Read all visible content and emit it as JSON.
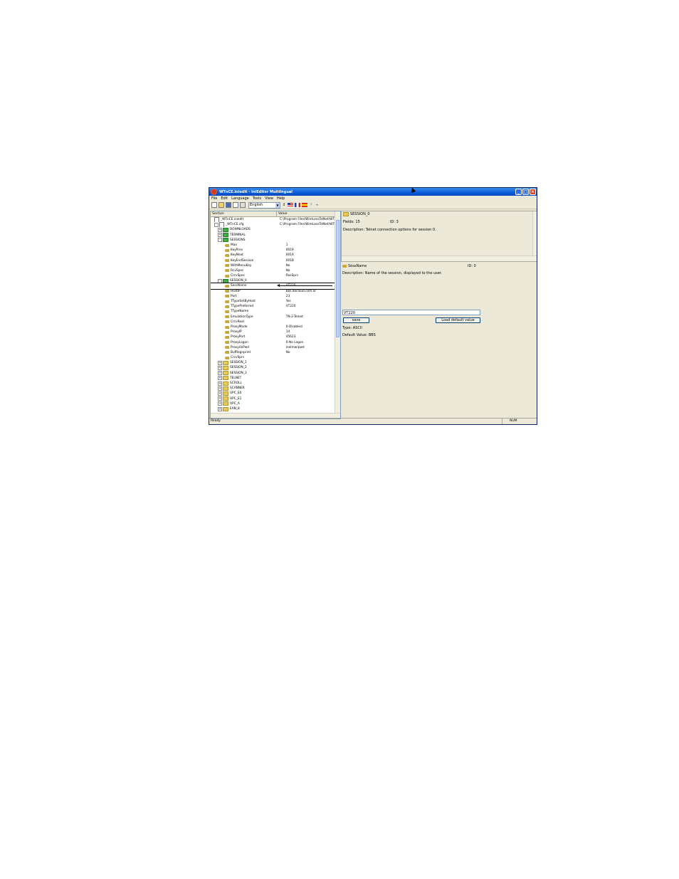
{
  "window": {
    "title": "WTnCE.inledit - IniEditor MultiIngual"
  },
  "menu": [
    "File",
    "Edit",
    "Language",
    "Tools",
    "View",
    "Help"
  ],
  "toolbar": {
    "language": "English"
  },
  "tree": {
    "headers": {
      "section": "Section",
      "value": "Value"
    },
    "rows": [
      {
        "label": "_WTnCE.iniedit",
        "value": "C:\\Program Files\\WireLessTelNet\\WTn",
        "indent": 1,
        "icon": "file",
        "exp": ""
      },
      {
        "label": "_WTnCE.cfg",
        "value": "C:\\Program Files\\WireLessTelNet\\WTn",
        "indent": 1,
        "icon": "file",
        "exp": "-"
      },
      {
        "label": "DOWNLOADS",
        "value": "",
        "indent": 2,
        "icon": "folder-open",
        "exp": "+"
      },
      {
        "label": "TERMINAL",
        "value": "",
        "indent": 2,
        "icon": "folder-open",
        "exp": "+"
      },
      {
        "label": "SESSIONS",
        "value": "",
        "indent": 2,
        "icon": "folder-open",
        "exp": "-"
      },
      {
        "label": "Max",
        "value": "1",
        "indent": 4,
        "icon": "key",
        "exp": ""
      },
      {
        "label": "KeyPrev",
        "value": "0019",
        "indent": 4,
        "icon": "key",
        "exp": ""
      },
      {
        "label": "KeyNext",
        "value": "001A",
        "indent": 4,
        "icon": "key",
        "exp": ""
      },
      {
        "label": "KeyEndSession",
        "value": "001B",
        "indent": 4,
        "icon": "key",
        "exp": ""
      },
      {
        "label": "WithMenuKey",
        "value": "No",
        "indent": 4,
        "icon": "key",
        "exp": ""
      },
      {
        "label": "RcvSpec",
        "value": "No",
        "indent": 4,
        "icon": "key",
        "exp": ""
      },
      {
        "label": "CrcvSpec",
        "value": "RasSprs",
        "indent": 4,
        "icon": "key",
        "exp": ""
      },
      {
        "label": "SESSION_0",
        "value": "",
        "indent": 2,
        "icon": "folder-open",
        "exp": "-"
      },
      {
        "label": "SessName",
        "value": "VT220",
        "indent": 4,
        "icon": "key",
        "exp": "",
        "selected": true
      },
      {
        "label": "HostIP",
        "value": "bbs.docloud.com.ar",
        "indent": 4,
        "icon": "key",
        "exp": ""
      },
      {
        "label": "Port",
        "value": "23",
        "indent": 4,
        "icon": "key",
        "exp": ""
      },
      {
        "label": "TTypeSetByHost",
        "value": "Yes",
        "indent": 4,
        "icon": "key",
        "exp": ""
      },
      {
        "label": "TTypePreferred",
        "value": "VT220",
        "indent": 4,
        "icon": "key",
        "exp": ""
      },
      {
        "label": "TTypeName",
        "value": "",
        "indent": 4,
        "icon": "key",
        "exp": ""
      },
      {
        "label": "EmulationType",
        "value": "TN-2-Telnet",
        "indent": 4,
        "icon": "key",
        "exp": ""
      },
      {
        "label": "CrcvReal",
        "value": "",
        "indent": 4,
        "icon": "key",
        "exp": ""
      },
      {
        "label": "ProxyMode",
        "value": "0-Disabled",
        "indent": 4,
        "icon": "key",
        "exp": ""
      },
      {
        "label": "ProxyIP",
        "value": "14",
        "indent": 4,
        "icon": "key",
        "exp": ""
      },
      {
        "label": "ProxyPort",
        "value": "45623",
        "indent": 4,
        "icon": "key",
        "exp": ""
      },
      {
        "label": "ProxyLogon",
        "value": "0-No Logon",
        "indent": 4,
        "icon": "key",
        "exp": ""
      },
      {
        "label": "ProxyUsPwd",
        "value": "inelmw/pwd",
        "indent": 4,
        "icon": "key",
        "exp": ""
      },
      {
        "label": "BufRegnprint",
        "value": "No",
        "indent": 4,
        "icon": "key",
        "exp": ""
      },
      {
        "label": "CrcvSprs",
        "value": "",
        "indent": 4,
        "icon": "key",
        "exp": ""
      },
      {
        "label": "SESSION_1",
        "value": "",
        "indent": 2,
        "icon": "folder",
        "exp": "+"
      },
      {
        "label": "SESSION_2",
        "value": "",
        "indent": 2,
        "icon": "folder",
        "exp": "+"
      },
      {
        "label": "SESSION_3",
        "value": "",
        "indent": 2,
        "icon": "folder",
        "exp": "+"
      },
      {
        "label": "TELNET",
        "value": "",
        "indent": 2,
        "icon": "folder",
        "exp": "+"
      },
      {
        "label": "SCROLL",
        "value": "",
        "indent": 2,
        "icon": "folder",
        "exp": "+"
      },
      {
        "label": "SCANNER",
        "value": "",
        "indent": 2,
        "icon": "folder",
        "exp": "+"
      },
      {
        "label": "UPC_E0",
        "value": "",
        "indent": 2,
        "icon": "folder",
        "exp": "+"
      },
      {
        "label": "UPC_E1",
        "value": "",
        "indent": 2,
        "icon": "folder",
        "exp": "+"
      },
      {
        "label": "UPC_A",
        "value": "",
        "indent": 2,
        "icon": "folder",
        "exp": "+"
      },
      {
        "label": "EAN_8",
        "value": "",
        "indent": 2,
        "icon": "folder",
        "exp": "+"
      }
    ]
  },
  "section_info": {
    "name": "SESSION_0",
    "fields": "Fields: 15",
    "id": "ID: 3",
    "description": "Description: Telnet connection options for session 0."
  },
  "key_info": {
    "name": "SessName",
    "id": "ID: 0",
    "description": "Description: Name of the session, displayed to the user.",
    "value": "VT220",
    "save_label": "save",
    "load_default_label": "Load default value",
    "type": "Type: ASCII",
    "default_value": "Default Value: BBS"
  },
  "status": {
    "text": "Ready",
    "num": "NUM"
  }
}
